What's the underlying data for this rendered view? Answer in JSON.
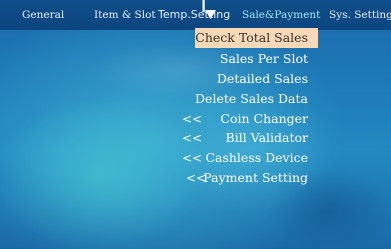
{
  "tabs": [
    {
      "label": "General"
    },
    {
      "label": "Item & Slot"
    },
    {
      "label": "Temp.Setting"
    },
    {
      "label": "Sale&Payment"
    },
    {
      "label": "Sys. Setting"
    }
  ],
  "active_tab": "Sale&Payment",
  "menu": {
    "selected": "Check Total Sales",
    "items": [
      {
        "label": "Sales Per Slot"
      },
      {
        "label": "Detailed Sales"
      },
      {
        "label": "Delete Sales Data"
      },
      {
        "label": "Coin Changer",
        "prefix": "<<"
      },
      {
        "label": "Bill Validator",
        "prefix": "<<"
      },
      {
        "label": "Cashless Device",
        "prefix": "<<"
      },
      {
        "label": "Payment Setting",
        "prefix": "<<"
      }
    ]
  },
  "colors": {
    "tabbar": "#0f4e8a",
    "active_tab_text": "#9fe8f5",
    "selection_bg": "#f8d9b7",
    "background": "#1e7bb8"
  }
}
